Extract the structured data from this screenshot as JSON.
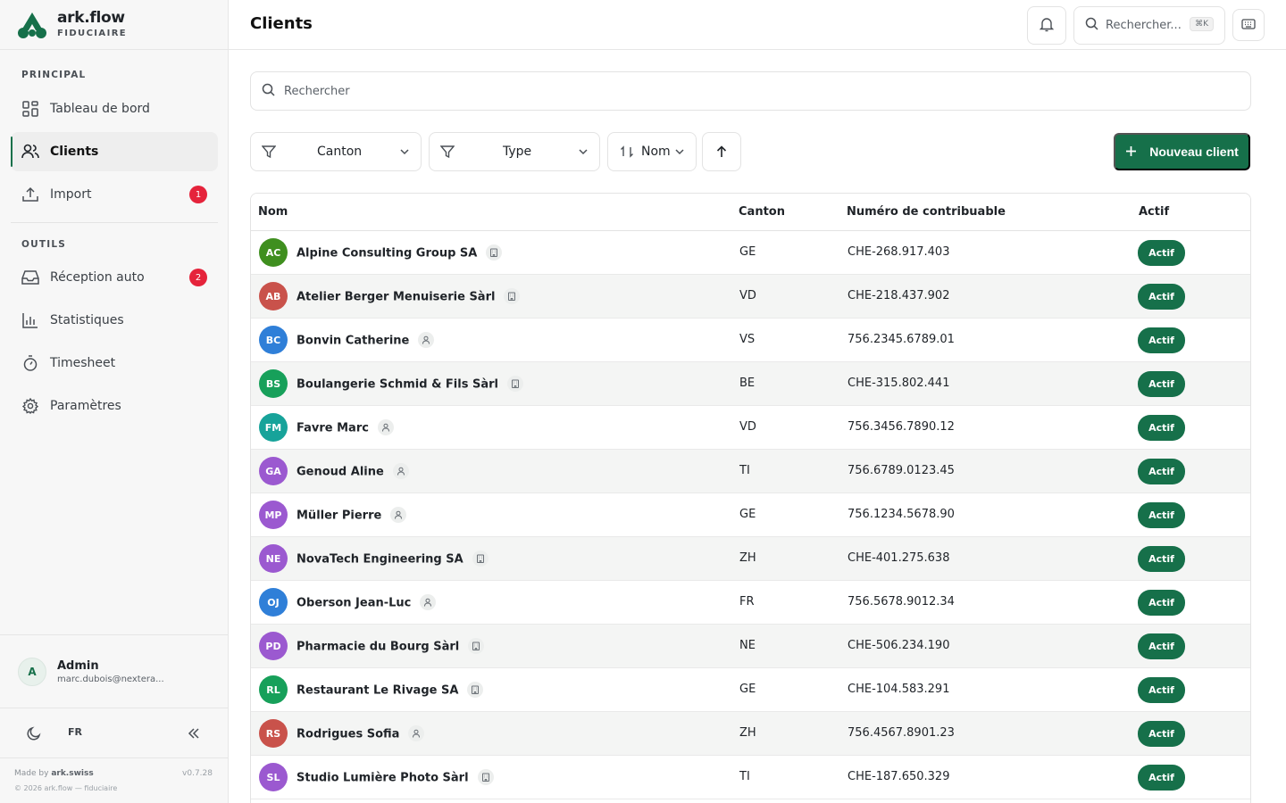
{
  "brand": {
    "name": "ark.flow",
    "subtitle": "FIDUCIAIRE"
  },
  "sidebar": {
    "sections": [
      {
        "label": "PRINCIPAL"
      },
      {
        "label": "OUTILS"
      }
    ],
    "items": [
      {
        "label": "Tableau de bord",
        "icon": "dashboard-icon"
      },
      {
        "label": "Clients",
        "icon": "users-icon",
        "active": true
      },
      {
        "label": "Import",
        "icon": "upload-icon",
        "badge": "1"
      },
      {
        "label": "Réception auto",
        "icon": "inbox-icon",
        "badge": "2"
      },
      {
        "label": "Statistiques",
        "icon": "bar-chart-icon"
      },
      {
        "label": "Timesheet",
        "icon": "stopwatch-icon"
      },
      {
        "label": "Paramètres",
        "icon": "gear-icon"
      }
    ],
    "user": {
      "initial": "A",
      "name": "Admin",
      "email": "marc.dubois@nextera..."
    },
    "footer": {
      "lang": "FR",
      "made_by_prefix": "Made by",
      "made_by_name": "ark.swiss",
      "version": "v0.7.28",
      "copyright": "© 2026 ark.flow — fiduciaire"
    }
  },
  "header": {
    "title": "Clients",
    "search_label": "Rechercher...",
    "shortcut": "⌘K"
  },
  "main": {
    "search_placeholder": "Rechercher",
    "filters": {
      "canton": "Canton",
      "type": "Type",
      "sort": "Nom"
    },
    "new_client": "Nouveau client",
    "columns": [
      "Nom",
      "Canton",
      "Numéro de contribuable",
      "Actif"
    ]
  },
  "colors": {
    "accent": "#16704a",
    "badge": "#e5233b"
  },
  "rows": [
    {
      "initials": "AC",
      "color": "#3f8f1f",
      "name": "Alpine Consulting Group SA",
      "kind": "company",
      "canton": "GE",
      "number": "CHE-268.917.403",
      "status": "Actif"
    },
    {
      "initials": "AB",
      "color": "#c9524b",
      "name": "Atelier Berger Menuiserie Sàrl",
      "kind": "company",
      "canton": "VD",
      "number": "CHE-218.437.902",
      "status": "Actif"
    },
    {
      "initials": "BC",
      "color": "#2f7fd8",
      "name": "Bonvin Catherine",
      "kind": "person",
      "canton": "VS",
      "number": "756.2345.6789.01",
      "status": "Actif"
    },
    {
      "initials": "BS",
      "color": "#17a05a",
      "name": "Boulangerie Schmid & Fils Sàrl",
      "kind": "company",
      "canton": "BE",
      "number": "CHE-315.802.441",
      "status": "Actif"
    },
    {
      "initials": "FM",
      "color": "#17a39a",
      "name": "Favre Marc",
      "kind": "person",
      "canton": "VD",
      "number": "756.3456.7890.12",
      "status": "Actif"
    },
    {
      "initials": "GA",
      "color": "#9b59d0",
      "name": "Genoud Aline",
      "kind": "person",
      "canton": "TI",
      "number": "756.6789.0123.45",
      "status": "Actif"
    },
    {
      "initials": "MP",
      "color": "#9b59d0",
      "name": "Müller Pierre",
      "kind": "person",
      "canton": "GE",
      "number": "756.1234.5678.90",
      "status": "Actif"
    },
    {
      "initials": "NE",
      "color": "#9b59d0",
      "name": "NovaTech Engineering SA",
      "kind": "company",
      "canton": "ZH",
      "number": "CHE-401.275.638",
      "status": "Actif"
    },
    {
      "initials": "OJ",
      "color": "#2f7fd8",
      "name": "Oberson Jean-Luc",
      "kind": "person",
      "canton": "FR",
      "number": "756.5678.9012.34",
      "status": "Actif"
    },
    {
      "initials": "PD",
      "color": "#9b59d0",
      "name": "Pharmacie du Bourg Sàrl",
      "kind": "company",
      "canton": "NE",
      "number": "CHE-506.234.190",
      "status": "Actif"
    },
    {
      "initials": "RL",
      "color": "#17a05a",
      "name": "Restaurant Le Rivage SA",
      "kind": "company",
      "canton": "GE",
      "number": "CHE-104.583.291",
      "status": "Actif"
    },
    {
      "initials": "RS",
      "color": "#c9524b",
      "name": "Rodrigues Sofia",
      "kind": "person",
      "canton": "ZH",
      "number": "756.4567.8901.23",
      "status": "Actif"
    },
    {
      "initials": "SL",
      "color": "#9b59d0",
      "name": "Studio Lumière Photo Sàrl",
      "kind": "company",
      "canton": "TI",
      "number": "CHE-187.650.329",
      "status": "Actif"
    }
  ]
}
